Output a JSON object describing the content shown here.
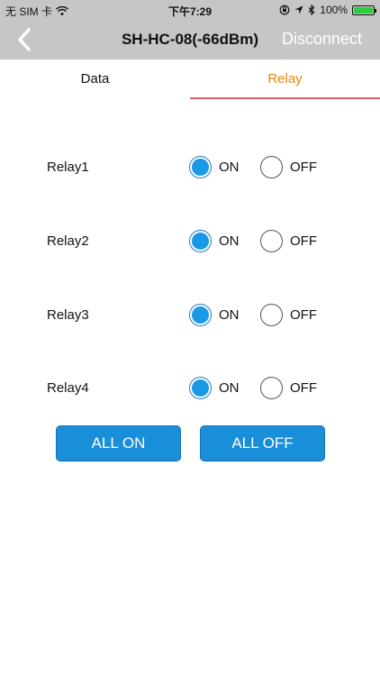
{
  "status_bar": {
    "carrier": "无 SIM 卡",
    "time": "下午7:29",
    "battery": "100%"
  },
  "nav": {
    "title": "SH-HC-08(-66dBm)",
    "disconnect_label": "Disconnect"
  },
  "tabs": [
    {
      "label": "Data",
      "active": false
    },
    {
      "label": "Relay",
      "active": true
    }
  ],
  "relays": [
    {
      "label": "Relay1",
      "on_label": "ON",
      "off_label": "OFF",
      "state": "ON"
    },
    {
      "label": "Relay2",
      "on_label": "ON",
      "off_label": "OFF",
      "state": "ON"
    },
    {
      "label": "Relay3",
      "on_label": "ON",
      "off_label": "OFF",
      "state": "ON"
    },
    {
      "label": "Relay4",
      "on_label": "ON",
      "off_label": "OFF",
      "state": "ON"
    }
  ],
  "buttons": {
    "all_on": "ALL ON",
    "all_off": "ALL OFF"
  },
  "colors": {
    "accent_blue": "#1a8fd9",
    "tab_active": "#e8890c",
    "tab_underline": "#e05a6a",
    "nav_bg": "#c6c6c6"
  }
}
